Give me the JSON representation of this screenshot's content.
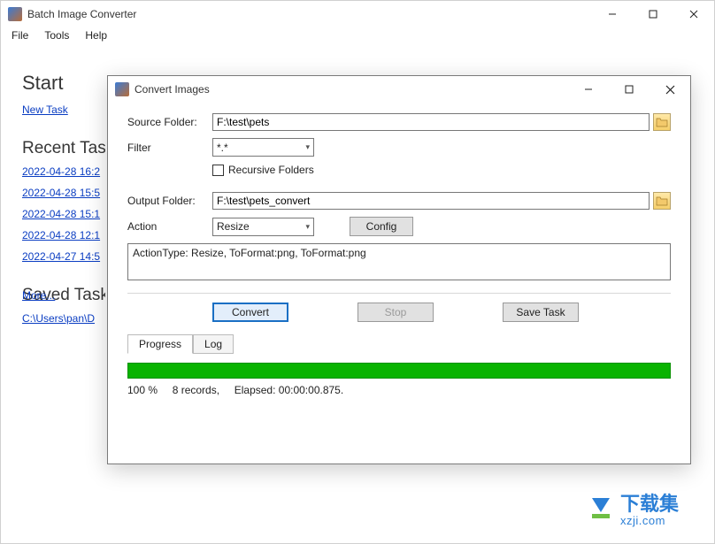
{
  "main_window": {
    "title": "Batch Image Converter",
    "menu": [
      "File",
      "Tools",
      "Help"
    ],
    "start_heading": "Start",
    "new_task_link": "New Task",
    "recent_heading": "Recent Tas",
    "recent_items": [
      "2022-04-28 16:2",
      "2022-04-28 15:5",
      "2022-04-28 15:1",
      "2022-04-28 12:1",
      "2022-04-27 14:5"
    ],
    "saved_heading": "Saved Task",
    "saved_items": [
      "C:\\Users\\pan\\D"
    ],
    "more_link": "More..."
  },
  "dialog": {
    "title": "Convert Images",
    "labels": {
      "source": "Source Folder:",
      "filter": "Filter",
      "recursive": "Recursive Folders",
      "output": "Output Folder:",
      "action": "Action"
    },
    "values": {
      "source": "F:\\test\\pets",
      "filter": "*.*",
      "output": "F:\\test\\pets_convert",
      "action": "Resize"
    },
    "buttons": {
      "config": "Config",
      "convert": "Convert",
      "stop": "Stop",
      "save_task": "Save Task"
    },
    "summary": "ActionType: Resize, ToFormat:png, ToFormat:png",
    "tabs": {
      "progress": "Progress",
      "log": "Log"
    },
    "progress": {
      "percent": "100 %",
      "records": "8 records,",
      "elapsed_label": "Elapsed:",
      "elapsed_val": "00:00:00.875."
    }
  },
  "watermark": {
    "cn": "下载集",
    "url": "xzji.com"
  }
}
